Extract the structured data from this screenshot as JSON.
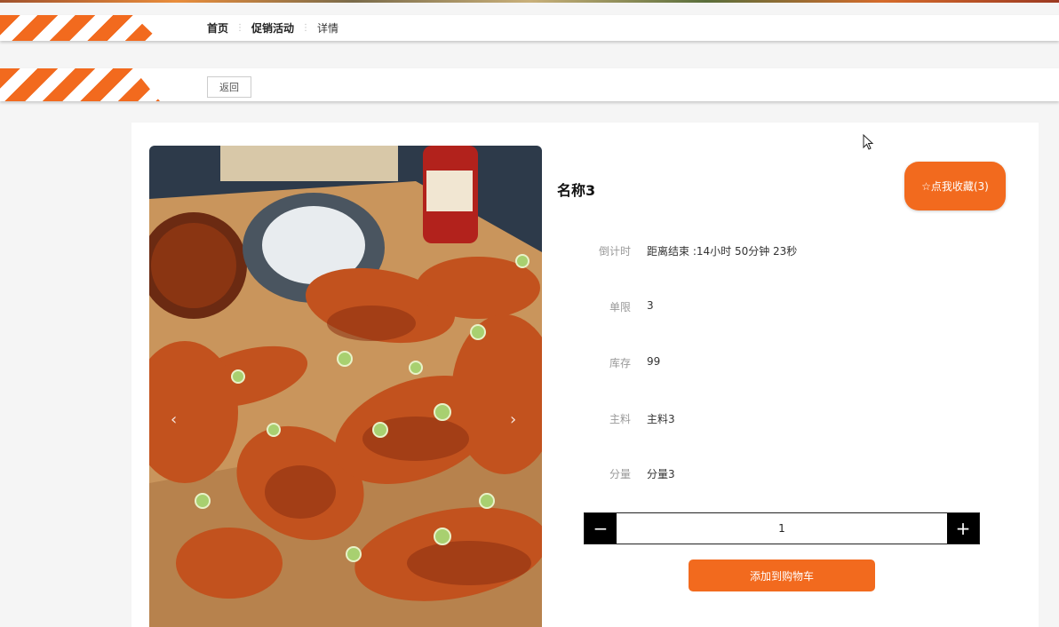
{
  "breadcrumb": {
    "home": "首页",
    "promotion": "促销活动",
    "detail": "详情",
    "separator": "⋮"
  },
  "toolbar": {
    "back_label": "返回"
  },
  "product": {
    "name": "名称3",
    "favorite_label": "☆点我收藏(3)",
    "fields": [
      {
        "label": "倒计时",
        "value": "距离结束 :14小时 50分钟 23秒"
      },
      {
        "label": "单限",
        "value": "3"
      },
      {
        "label": "库存",
        "value": "99"
      },
      {
        "label": "主料",
        "value": "主料3"
      },
      {
        "label": "分量",
        "value": "分量3"
      }
    ],
    "quantity": "1",
    "add_to_cart_label": "添加到购物车"
  },
  "carousel": {
    "prev": "‹",
    "next": "›"
  },
  "stepper": {
    "minus": "−",
    "plus": "+"
  },
  "colors": {
    "accent": "#f26a1e",
    "stepper": "#000000"
  }
}
